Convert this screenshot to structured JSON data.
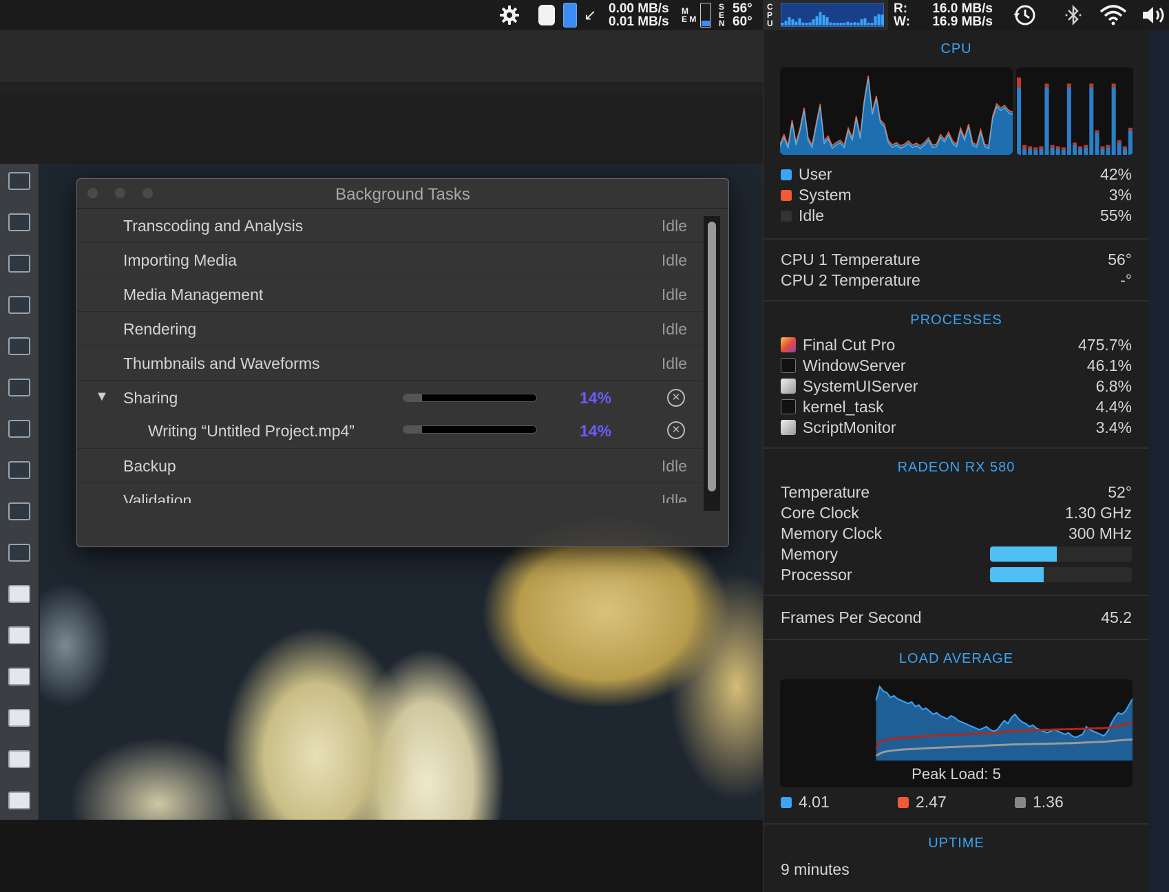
{
  "menubar": {
    "net_down": "0.00 MB/s",
    "net_up": "0.01 MB/s",
    "mem_label_top": "M",
    "mem_label_bottom": "E M",
    "sensor_label": "S E N",
    "sensor_temp_1": "56°",
    "sensor_temp_2": "60°",
    "cpu_label": "C P U",
    "disk_r_label": "R:",
    "disk_w_label": "W:",
    "disk_read": "16.0 MB/s",
    "disk_write": "16.9 MB/s"
  },
  "background_tasks": {
    "title": "Background Tasks",
    "tasks": [
      {
        "name": "Transcoding and Analysis",
        "status": "Idle"
      },
      {
        "name": "Importing Media",
        "status": "Idle"
      },
      {
        "name": "Media Management",
        "status": "Idle"
      },
      {
        "name": "Rendering",
        "status": "Idle"
      },
      {
        "name": "Thumbnails and Waveforms",
        "status": "Idle"
      }
    ],
    "sharing": {
      "name": "Sharing",
      "progress": 14,
      "percent_label": "14%",
      "expand_glyph": "▼"
    },
    "writing": {
      "name": "Writing “Untitled Project.mp4”",
      "progress": 14,
      "percent_label": "14%"
    },
    "backup": {
      "name": "Backup",
      "status": "Idle"
    },
    "validation": {
      "name": "Validation",
      "status": "Idle"
    }
  },
  "istat": {
    "cpu": {
      "title": "CPU",
      "user_label": "User",
      "user_value": "42%",
      "system_label": "System",
      "system_value": "3%",
      "idle_label": "Idle",
      "idle_value": "55%",
      "user_color": "#3ba4f5",
      "system_color": "#f05a35",
      "idle_color": "#333333",
      "temp1_label": "CPU 1 Temperature",
      "temp1_value": "56°",
      "temp2_label": "CPU 2 Temperature",
      "temp2_value": "-°",
      "history": [
        10,
        22,
        8,
        40,
        12,
        30,
        55,
        18,
        9,
        35,
        60,
        14,
        20,
        8,
        12,
        15,
        9,
        30,
        18,
        45,
        20,
        65,
        95,
        50,
        70,
        40,
        35,
        15,
        9,
        12,
        8,
        10,
        14,
        9,
        11,
        8,
        12,
        18,
        9,
        10,
        22,
        16,
        25,
        14,
        10,
        30,
        18,
        35,
        12,
        9,
        28,
        10,
        8,
        45,
        60,
        55,
        58,
        52,
        50
      ],
      "core_user": [
        55,
        5,
        5,
        4,
        5,
        55,
        6,
        5,
        4,
        55,
        8,
        5,
        6,
        55,
        18,
        5,
        6,
        55,
        10,
        5,
        20
      ],
      "core_system": [
        8,
        3,
        2,
        2,
        2,
        3,
        2,
        2,
        2,
        3,
        2,
        2,
        2,
        3,
        2,
        2,
        2,
        3,
        2,
        2,
        2
      ]
    },
    "processes": {
      "title": "PROCESSES",
      "items": [
        {
          "name": "Final Cut Pro",
          "value": "475.7%",
          "icon": "final-cut-pro-icon"
        },
        {
          "name": "WindowServer",
          "value": "46.1%",
          "icon": "terminal-icon"
        },
        {
          "name": "SystemUIServer",
          "value": "6.8%",
          "icon": "script-icon"
        },
        {
          "name": "kernel_task",
          "value": "4.4%",
          "icon": "terminal-icon"
        },
        {
          "name": "ScriptMonitor",
          "value": "3.4%",
          "icon": "script-icon"
        }
      ]
    },
    "gpu": {
      "title": "RADEON RX 580",
      "temp_label": "Temperature",
      "temp_value": "52°",
      "core_label": "Core Clock",
      "core_value": "1.30 GHz",
      "memclock_label": "Memory Clock",
      "memclock_value": "300 MHz",
      "memory_label": "Memory",
      "memory_level": 0.47,
      "processor_label": "Processor",
      "processor_level": 0.38
    },
    "fps": {
      "label": "Frames Per Second",
      "value": "45.2"
    },
    "load": {
      "title": "LOAD AVERAGE",
      "peak_label": "Peak Load: 5",
      "peak": 5,
      "avg1": "4.01",
      "avg5": "2.47",
      "avg15": "1.36",
      "color1": "#3ba4f5",
      "color5": "#f05a35",
      "color15": "#888888",
      "series1": [
        0,
        0,
        0,
        0,
        0,
        0,
        0,
        0,
        0,
        0,
        0,
        0,
        0,
        0,
        0,
        0,
        0,
        0,
        0,
        0,
        0,
        0,
        0,
        0,
        0,
        0,
        0,
        3.9,
        4.8,
        4.5,
        4.4,
        4.1,
        4.2,
        4.0,
        3.9,
        3.8,
        3.7,
        3.8,
        3.5,
        3.6,
        3.3,
        3.4,
        3.2,
        3.0,
        3.1,
        2.9,
        2.8,
        2.7,
        2.9,
        2.8,
        2.6,
        2.5,
        2.4,
        2.3,
        2.2,
        2.1,
        2.0,
        2.1,
        2.2,
        2.0,
        1.9,
        2.0,
        2.3,
        2.6,
        2.4,
        2.8,
        3.0,
        2.7,
        2.5,
        2.4,
        2.2,
        2.3,
        2.1,
        2.0,
        1.9,
        1.8,
        1.9,
        2.0,
        1.9,
        1.8,
        1.7,
        1.8,
        1.6,
        1.5,
        1.6,
        1.7,
        2.2,
        2.0,
        1.9,
        1.8,
        1.7,
        1.6,
        1.9,
        2.4,
        2.8,
        3.1,
        3.0,
        3.2,
        3.6,
        4.01
      ],
      "series5": [
        0,
        0,
        0,
        0,
        0,
        0,
        0,
        0,
        0,
        0,
        0,
        0,
        0,
        0,
        0,
        0,
        0,
        0,
        0,
        0,
        0,
        0,
        0,
        0,
        0,
        0,
        0,
        0.8,
        1.2,
        1.3,
        1.35,
        1.4,
        1.42,
        1.45,
        1.47,
        1.48,
        1.5,
        1.52,
        1.55,
        1.56,
        1.57,
        1.58,
        1.6,
        1.62,
        1.62,
        1.63,
        1.64,
        1.65,
        1.66,
        1.68,
        1.69,
        1.7,
        1.71,
        1.72,
        1.73,
        1.74,
        1.75,
        1.76,
        1.77,
        1.78,
        1.8,
        1.82,
        1.84,
        1.86,
        1.88,
        1.9,
        1.92,
        1.93,
        1.94,
        1.95,
        1.96,
        1.97,
        1.98,
        1.98,
        1.99,
        2.0,
        2.0,
        2.01,
        2.01,
        2.02,
        2.02,
        2.03,
        2.03,
        2.04,
        2.05,
        2.06,
        2.07,
        2.08,
        2.09,
        2.1,
        2.1,
        2.11,
        2.12,
        2.15,
        2.2,
        2.25,
        2.3,
        2.35,
        2.4,
        2.47
      ],
      "series15": [
        0,
        0,
        0,
        0,
        0,
        0,
        0,
        0,
        0,
        0,
        0,
        0,
        0,
        0,
        0,
        0,
        0,
        0,
        0,
        0,
        0,
        0,
        0,
        0,
        0,
        0,
        0,
        0.3,
        0.45,
        0.55,
        0.6,
        0.63,
        0.66,
        0.68,
        0.7,
        0.72,
        0.73,
        0.75,
        0.76,
        0.77,
        0.78,
        0.8,
        0.81,
        0.82,
        0.83,
        0.84,
        0.85,
        0.86,
        0.87,
        0.88,
        0.89,
        0.9,
        0.91,
        0.92,
        0.93,
        0.94,
        0.95,
        0.96,
        0.97,
        0.98,
        0.99,
        1.0,
        1.01,
        1.02,
        1.03,
        1.04,
        1.05,
        1.05,
        1.06,
        1.06,
        1.07,
        1.07,
        1.08,
        1.08,
        1.09,
        1.09,
        1.1,
        1.1,
        1.11,
        1.11,
        1.12,
        1.12,
        1.13,
        1.14,
        1.15,
        1.16,
        1.17,
        1.18,
        1.19,
        1.2,
        1.21,
        1.22,
        1.24,
        1.26,
        1.28,
        1.3,
        1.32,
        1.34,
        1.35,
        1.36
      ]
    },
    "uptime": {
      "title": "UPTIME",
      "value": "9 minutes"
    }
  }
}
